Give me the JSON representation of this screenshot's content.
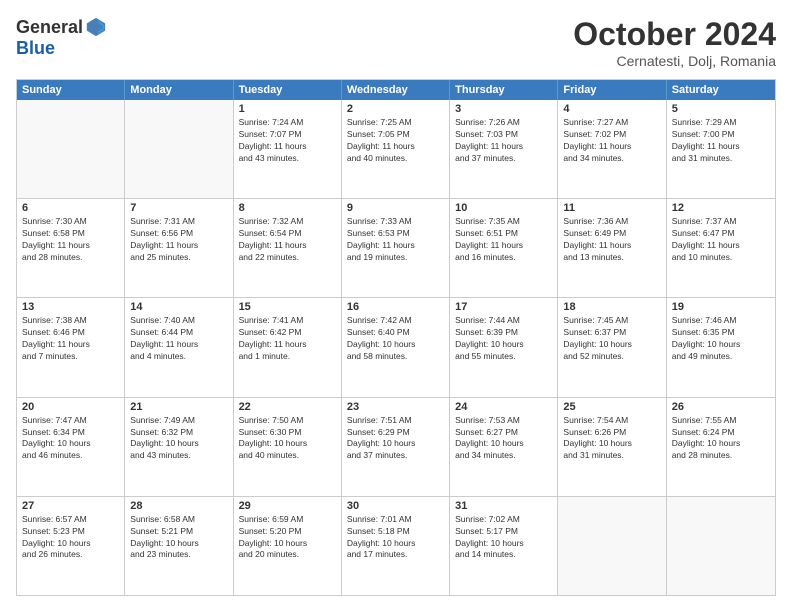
{
  "header": {
    "logo_general": "General",
    "logo_blue": "Blue",
    "title": "October 2024",
    "subtitle": "Cernatesti, Dolj, Romania"
  },
  "days": [
    "Sunday",
    "Monday",
    "Tuesday",
    "Wednesday",
    "Thursday",
    "Friday",
    "Saturday"
  ],
  "weeks": [
    [
      {
        "day": "",
        "lines": []
      },
      {
        "day": "",
        "lines": []
      },
      {
        "day": "1",
        "lines": [
          "Sunrise: 7:24 AM",
          "Sunset: 7:07 PM",
          "Daylight: 11 hours",
          "and 43 minutes."
        ]
      },
      {
        "day": "2",
        "lines": [
          "Sunrise: 7:25 AM",
          "Sunset: 7:05 PM",
          "Daylight: 11 hours",
          "and 40 minutes."
        ]
      },
      {
        "day": "3",
        "lines": [
          "Sunrise: 7:26 AM",
          "Sunset: 7:03 PM",
          "Daylight: 11 hours",
          "and 37 minutes."
        ]
      },
      {
        "day": "4",
        "lines": [
          "Sunrise: 7:27 AM",
          "Sunset: 7:02 PM",
          "Daylight: 11 hours",
          "and 34 minutes."
        ]
      },
      {
        "day": "5",
        "lines": [
          "Sunrise: 7:29 AM",
          "Sunset: 7:00 PM",
          "Daylight: 11 hours",
          "and 31 minutes."
        ]
      }
    ],
    [
      {
        "day": "6",
        "lines": [
          "Sunrise: 7:30 AM",
          "Sunset: 6:58 PM",
          "Daylight: 11 hours",
          "and 28 minutes."
        ]
      },
      {
        "day": "7",
        "lines": [
          "Sunrise: 7:31 AM",
          "Sunset: 6:56 PM",
          "Daylight: 11 hours",
          "and 25 minutes."
        ]
      },
      {
        "day": "8",
        "lines": [
          "Sunrise: 7:32 AM",
          "Sunset: 6:54 PM",
          "Daylight: 11 hours",
          "and 22 minutes."
        ]
      },
      {
        "day": "9",
        "lines": [
          "Sunrise: 7:33 AM",
          "Sunset: 6:53 PM",
          "Daylight: 11 hours",
          "and 19 minutes."
        ]
      },
      {
        "day": "10",
        "lines": [
          "Sunrise: 7:35 AM",
          "Sunset: 6:51 PM",
          "Daylight: 11 hours",
          "and 16 minutes."
        ]
      },
      {
        "day": "11",
        "lines": [
          "Sunrise: 7:36 AM",
          "Sunset: 6:49 PM",
          "Daylight: 11 hours",
          "and 13 minutes."
        ]
      },
      {
        "day": "12",
        "lines": [
          "Sunrise: 7:37 AM",
          "Sunset: 6:47 PM",
          "Daylight: 11 hours",
          "and 10 minutes."
        ]
      }
    ],
    [
      {
        "day": "13",
        "lines": [
          "Sunrise: 7:38 AM",
          "Sunset: 6:46 PM",
          "Daylight: 11 hours",
          "and 7 minutes."
        ]
      },
      {
        "day": "14",
        "lines": [
          "Sunrise: 7:40 AM",
          "Sunset: 6:44 PM",
          "Daylight: 11 hours",
          "and 4 minutes."
        ]
      },
      {
        "day": "15",
        "lines": [
          "Sunrise: 7:41 AM",
          "Sunset: 6:42 PM",
          "Daylight: 11 hours",
          "and 1 minute."
        ]
      },
      {
        "day": "16",
        "lines": [
          "Sunrise: 7:42 AM",
          "Sunset: 6:40 PM",
          "Daylight: 10 hours",
          "and 58 minutes."
        ]
      },
      {
        "day": "17",
        "lines": [
          "Sunrise: 7:44 AM",
          "Sunset: 6:39 PM",
          "Daylight: 10 hours",
          "and 55 minutes."
        ]
      },
      {
        "day": "18",
        "lines": [
          "Sunrise: 7:45 AM",
          "Sunset: 6:37 PM",
          "Daylight: 10 hours",
          "and 52 minutes."
        ]
      },
      {
        "day": "19",
        "lines": [
          "Sunrise: 7:46 AM",
          "Sunset: 6:35 PM",
          "Daylight: 10 hours",
          "and 49 minutes."
        ]
      }
    ],
    [
      {
        "day": "20",
        "lines": [
          "Sunrise: 7:47 AM",
          "Sunset: 6:34 PM",
          "Daylight: 10 hours",
          "and 46 minutes."
        ]
      },
      {
        "day": "21",
        "lines": [
          "Sunrise: 7:49 AM",
          "Sunset: 6:32 PM",
          "Daylight: 10 hours",
          "and 43 minutes."
        ]
      },
      {
        "day": "22",
        "lines": [
          "Sunrise: 7:50 AM",
          "Sunset: 6:30 PM",
          "Daylight: 10 hours",
          "and 40 minutes."
        ]
      },
      {
        "day": "23",
        "lines": [
          "Sunrise: 7:51 AM",
          "Sunset: 6:29 PM",
          "Daylight: 10 hours",
          "and 37 minutes."
        ]
      },
      {
        "day": "24",
        "lines": [
          "Sunrise: 7:53 AM",
          "Sunset: 6:27 PM",
          "Daylight: 10 hours",
          "and 34 minutes."
        ]
      },
      {
        "day": "25",
        "lines": [
          "Sunrise: 7:54 AM",
          "Sunset: 6:26 PM",
          "Daylight: 10 hours",
          "and 31 minutes."
        ]
      },
      {
        "day": "26",
        "lines": [
          "Sunrise: 7:55 AM",
          "Sunset: 6:24 PM",
          "Daylight: 10 hours",
          "and 28 minutes."
        ]
      }
    ],
    [
      {
        "day": "27",
        "lines": [
          "Sunrise: 6:57 AM",
          "Sunset: 5:23 PM",
          "Daylight: 10 hours",
          "and 26 minutes."
        ]
      },
      {
        "day": "28",
        "lines": [
          "Sunrise: 6:58 AM",
          "Sunset: 5:21 PM",
          "Daylight: 10 hours",
          "and 23 minutes."
        ]
      },
      {
        "day": "29",
        "lines": [
          "Sunrise: 6:59 AM",
          "Sunset: 5:20 PM",
          "Daylight: 10 hours",
          "and 20 minutes."
        ]
      },
      {
        "day": "30",
        "lines": [
          "Sunrise: 7:01 AM",
          "Sunset: 5:18 PM",
          "Daylight: 10 hours",
          "and 17 minutes."
        ]
      },
      {
        "day": "31",
        "lines": [
          "Sunrise: 7:02 AM",
          "Sunset: 5:17 PM",
          "Daylight: 10 hours",
          "and 14 minutes."
        ]
      },
      {
        "day": "",
        "lines": []
      },
      {
        "day": "",
        "lines": []
      }
    ]
  ]
}
